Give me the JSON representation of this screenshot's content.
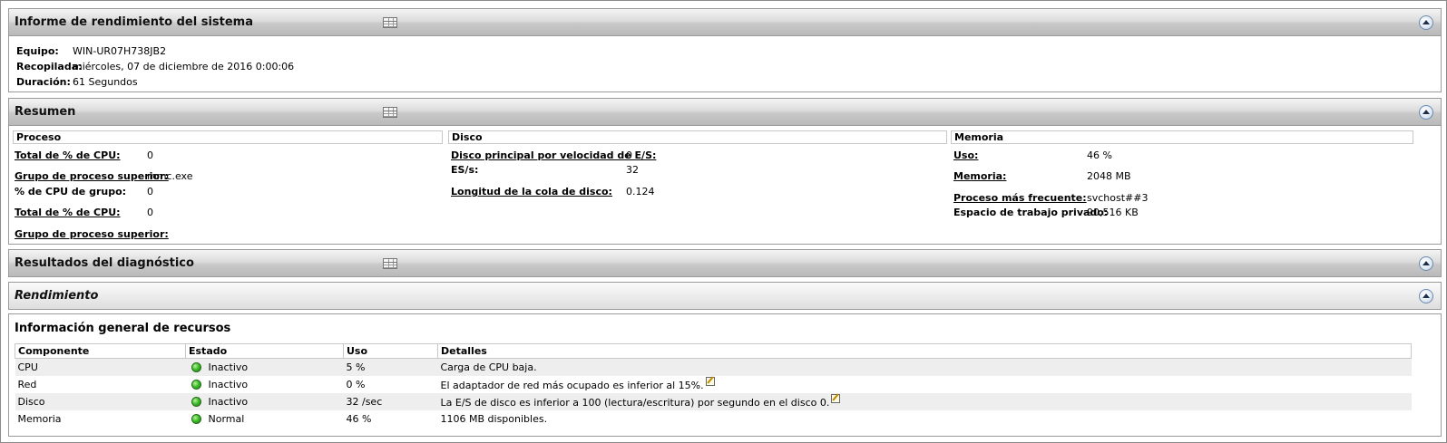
{
  "report": {
    "title": "Informe de rendimiento del sistema",
    "fields": [
      {
        "key": "Equipo:",
        "value": "WIN-UR07H738JB2"
      },
      {
        "key": "Recopilada:",
        "value": "miércoles, 07 de diciembre de 2016 0:00:06"
      },
      {
        "key": "Duración:",
        "value": "61 Segundos"
      }
    ]
  },
  "summary": {
    "title": "Resumen",
    "proceso": {
      "header": "Proceso",
      "rows": [
        {
          "key": "Total de % de CPU:",
          "value": "0"
        },
        {
          "key": "Grupo de proceso superior:",
          "value": "mmc.exe"
        },
        {
          "key": "% de CPU de grupo:",
          "value": "0"
        },
        {
          "key": "Total de % de CPU:",
          "value": "0"
        },
        {
          "key": "Grupo de proceso superior:",
          "value": ""
        }
      ]
    },
    "disco": {
      "header": "Disco",
      "rows": [
        {
          "key": "Disco principal por velocidad de E/S:",
          "value": "0"
        },
        {
          "key": "ES/s:",
          "value": "32"
        },
        {
          "key": "Longitud de la cola de disco:",
          "value": "0.124"
        }
      ]
    },
    "memoria": {
      "header": "Memoria",
      "rows": [
        {
          "key": "Uso:",
          "value": "46 %"
        },
        {
          "key": "Memoria:",
          "value": "2048 MB"
        },
        {
          "key": "Proceso más frecuente:",
          "value": "svchost##3"
        },
        {
          "key": "Espacio de trabajo privado:",
          "value": "90,516 KB"
        }
      ]
    }
  },
  "diagnostics": {
    "title": "Resultados del diagnóstico"
  },
  "performance": {
    "title": "Rendimiento"
  },
  "resources": {
    "title": "Información general de recursos",
    "columns": [
      "Componente",
      "Estado",
      "Uso",
      "Detalles"
    ],
    "rows": [
      {
        "component": "CPU",
        "state": "Inactivo",
        "usage": "5 %",
        "details": "Carga de CPU baja."
      },
      {
        "component": "Red",
        "state": "Inactivo",
        "usage": "0 %",
        "details": "El adaptador de red más ocupado es inferior al 15%."
      },
      {
        "component": "Disco",
        "state": "Inactivo",
        "usage": "32 /sec",
        "details": "La E/S de disco es inferior a 100 (lectura/escritura) por segundo en el disco 0."
      },
      {
        "component": "Memoria",
        "state": "Normal",
        "usage": "46 %",
        "details": "1106 MB disponibles."
      }
    ]
  },
  "icons": {
    "status": "green-status-dot-icon",
    "note": "edit-note-icon",
    "table": "table-view-icon",
    "collapse": "collapse-up-icon"
  }
}
